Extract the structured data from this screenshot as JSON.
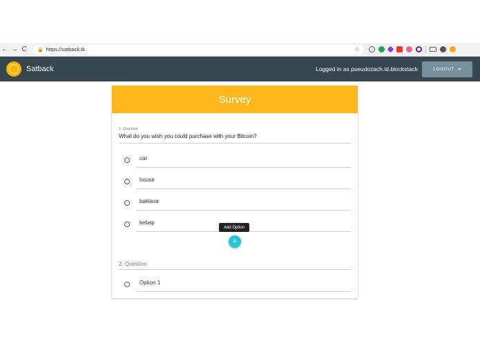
{
  "browser": {
    "url": "https://satback.tk",
    "back": "←",
    "forward": "→",
    "reload": "C",
    "star": "☆"
  },
  "app": {
    "brand": "Satback",
    "logged_in_text": "Logged in as pseudozach.id.blockstack",
    "logout_label": "LOGOUT"
  },
  "survey": {
    "title": "Survey",
    "question1": {
      "label": "1. Question",
      "text": "What do you wish you could purchase with your Bitcoin?",
      "options": [
        "car",
        "house",
        "baklava",
        "kebap"
      ]
    },
    "add_option_tooltip": "Add Option",
    "add_option_icon": "+",
    "question2": {
      "label": "2. Question",
      "options": [
        "Option 1"
      ]
    }
  },
  "colors": {
    "header_bg": "#37474f",
    "survey_head": "#ffb81c",
    "fab": "#26c6da",
    "logout_bg": "#78909c"
  }
}
